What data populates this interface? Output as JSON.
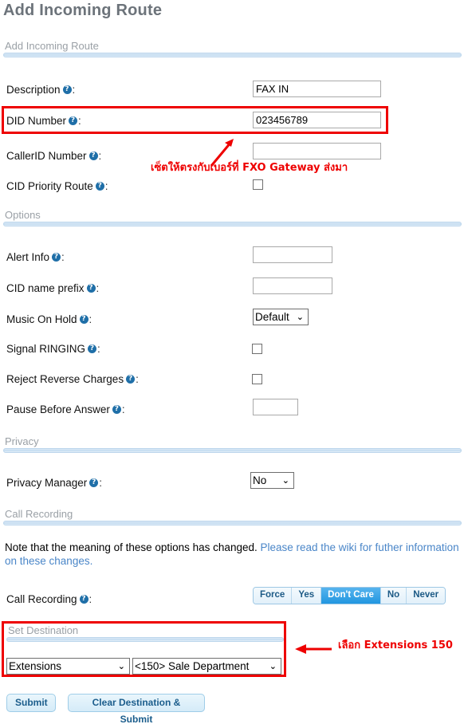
{
  "page": {
    "title": "Add Incoming Route"
  },
  "sections": {
    "add_incoming_route": "Add Incoming Route",
    "options": "Options",
    "privacy": "Privacy",
    "call_recording": "Call Recording",
    "set_destination": "Set Destination"
  },
  "fields": {
    "description": {
      "label": "Description",
      "value": "FAX IN",
      "placeholder": ""
    },
    "did_number": {
      "label": "DID Number",
      "value": "023456789",
      "placeholder": ""
    },
    "callerid_number": {
      "label": "CallerID Number",
      "value": "",
      "placeholder": ""
    },
    "cid_priority_route": {
      "label": "CID Priority Route",
      "checked": false
    },
    "alert_info": {
      "label": "Alert Info",
      "value": "",
      "placeholder": ""
    },
    "cid_name_prefix": {
      "label": "CID name prefix",
      "value": "",
      "placeholder": ""
    },
    "music_on_hold": {
      "label": "Music On Hold",
      "value": "Default",
      "options": [
        "Default"
      ]
    },
    "signal_ringing": {
      "label": "Signal RINGING",
      "checked": false
    },
    "reject_reverse_charges": {
      "label": "Reject Reverse Charges",
      "checked": false
    },
    "pause_before_answer": {
      "label": "Pause Before Answer",
      "value": "",
      "placeholder": ""
    },
    "privacy_manager": {
      "label": "Privacy Manager",
      "value": "No",
      "options": [
        "No"
      ]
    },
    "call_recording": {
      "label": "Call Recording",
      "options": [
        "Force",
        "Yes",
        "Don't Care",
        "No",
        "Never"
      ],
      "selected": "Don't Care"
    },
    "destination_type": {
      "value": "Extensions",
      "options": [
        "Extensions"
      ]
    },
    "destination_target": {
      "value": "<150> Sale Department",
      "options": [
        "<150> Sale Department"
      ]
    }
  },
  "note": {
    "plain": "Note that the meaning of these options has changed. ",
    "link": "Please read the wiki for futher information on these changes."
  },
  "buttons": {
    "submit": "Submit",
    "clear_destination_submit": "Clear Destination & Submit"
  },
  "annotations": {
    "did_note": "เซ็ตให้ตรงกับเบอร์ที่ FXO Gateway ส่งมา",
    "destination_note": "เลือก Extensions 150"
  },
  "icons": {
    "help": "?",
    "caret_down": "⌄"
  },
  "colors": {
    "title": "#6c737a",
    "section_label": "#9aa0a6",
    "divider": "#cfe2f3",
    "help_icon": "#1f6fa8",
    "link": "#4a86c8",
    "annotation": "#ee0000",
    "active_option": "#2196e0",
    "button_text": "#1b5d8c"
  }
}
